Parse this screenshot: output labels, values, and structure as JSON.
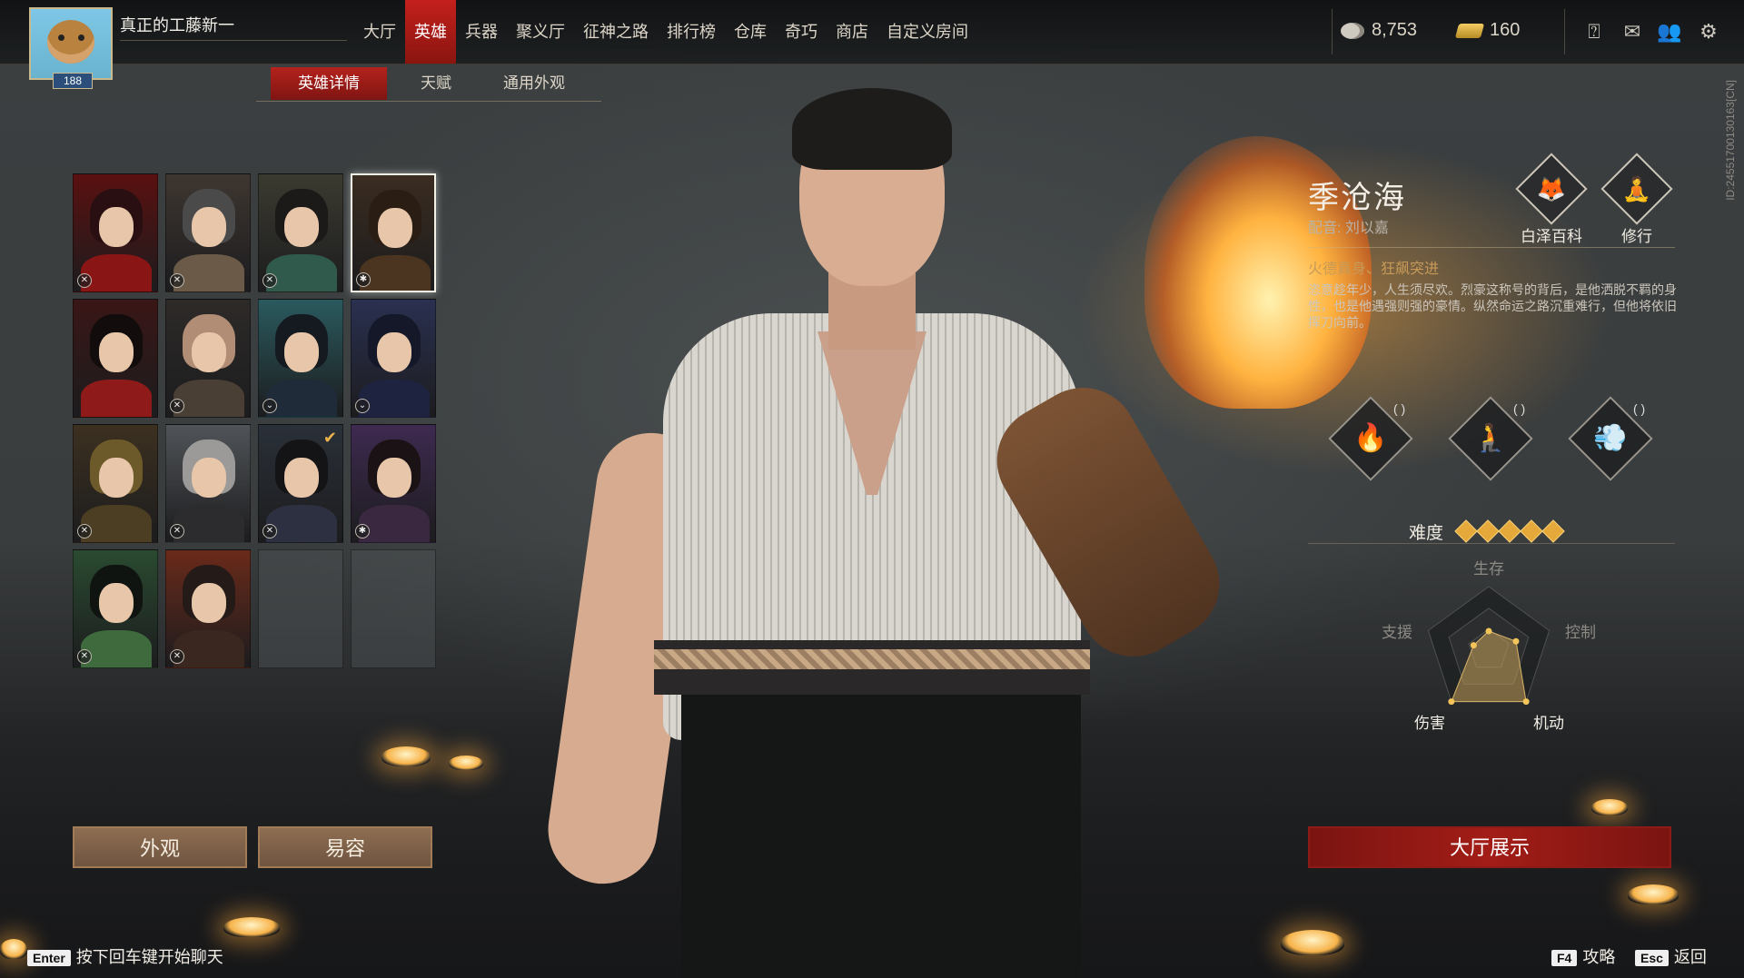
{
  "player": {
    "name": "真正的工藤新一",
    "level": "188"
  },
  "nav": {
    "tabs": [
      "大厅",
      "英雄",
      "兵器",
      "聚义厅",
      "征神之路",
      "排行榜",
      "仓库",
      "奇巧",
      "商店",
      "自定义房间"
    ],
    "active": "英雄"
  },
  "currency": {
    "silver": "8,753",
    "gold": "160"
  },
  "top_icons": [
    "help-icon",
    "mail-icon",
    "friends-icon",
    "settings-icon"
  ],
  "side_id": "ID:2455170013016​3[CN]",
  "subtabs": {
    "items": [
      "英雄详情",
      "天赋",
      "通用外观"
    ],
    "active": "英雄详情"
  },
  "heroes": [
    {
      "name": "hero-1",
      "badge": "✕",
      "hair": "#2a0f12",
      "body": "#8a1515",
      "bg": "#5a1010"
    },
    {
      "name": "hero-2",
      "badge": "✕",
      "hair": "#4a4a4a",
      "body": "#6b5a48",
      "bg": "#3e3630"
    },
    {
      "name": "hero-3",
      "badge": "✕",
      "hair": "#1c1a18",
      "body": "#2f5a4c",
      "bg": "#3b3a30"
    },
    {
      "name": "hero-4",
      "badge": "✱",
      "hair": "#2a1d14",
      "body": "#4b3420",
      "bg": "#3a2c20",
      "selected": true
    },
    {
      "name": "hero-5",
      "badge": "",
      "hair": "#120c0c",
      "body": "#8e1a1a",
      "bg": "#3a1616"
    },
    {
      "name": "hero-6",
      "badge": "✕",
      "hair": "#b08d74",
      "body": "#4a3f35",
      "bg": "#2d2a28"
    },
    {
      "name": "hero-7",
      "badge": "⌄",
      "hair": "#141a20",
      "body": "#1f2b38",
      "bg": "#2a5a5e"
    },
    {
      "name": "hero-8",
      "badge": "⌄",
      "hair": "#141828",
      "body": "#1e2440",
      "bg": "#2a3050"
    },
    {
      "name": "hero-9",
      "badge": "✕",
      "hair": "#6d5a2a",
      "body": "#4c3e22",
      "bg": "#3c3020"
    },
    {
      "name": "hero-10",
      "badge": "✕",
      "hair": "#9c9a98",
      "body": "#2c2c2e",
      "bg": "#505458"
    },
    {
      "name": "hero-11",
      "badge": "✕",
      "hair": "#141416",
      "body": "#2c3040",
      "bg": "#2a3038",
      "check": true
    },
    {
      "name": "hero-12",
      "badge": "✱",
      "hair": "#1a1214",
      "body": "#3a2840",
      "bg": "#3e2a50"
    },
    {
      "name": "hero-13",
      "badge": "✕",
      "hair": "#101410",
      "body": "#3e6a3e",
      "bg": "#2a4a30"
    },
    {
      "name": "hero-14",
      "badge": "✕",
      "hair": "#241a18",
      "body": "#3a2820",
      "bg": "#6a2a1a"
    },
    {
      "name": "empty-1",
      "empty": true
    },
    {
      "name": "empty-2",
      "empty": true
    }
  ],
  "buttons": {
    "appearance": "外观",
    "face": "易容",
    "lobby_show": "大厅展示"
  },
  "hero": {
    "name": "季沧海",
    "voice": "配音: 刘以嘉",
    "wiki": "白泽百科",
    "training": "修行",
    "subtitle": "火德真身、狂飙突进",
    "desc": "恣意趁年少，人生须尽欢。烈豪这称号的背后，是他洒脱不羁的身性，也是他遇强则强的豪情。纵然命运之路沉重难行，但他将依旧挥刀向前。",
    "difficulty_label": "难度",
    "difficulty": 5
  },
  "radar": {
    "labels": {
      "survival": "生存",
      "support": "支援",
      "control": "控制",
      "damage": "伤害",
      "mobility": "机动"
    },
    "values": {
      "survival": 0.3,
      "control": 0.45,
      "mobility": 1.0,
      "damage": 1.0,
      "support": 0.25
    }
  },
  "hints": {
    "chat_key": "Enter",
    "chat": "按下回车键开始聊天",
    "guide_key": "F4",
    "guide": "攻略",
    "back_key": "Esc",
    "back": "返回"
  }
}
